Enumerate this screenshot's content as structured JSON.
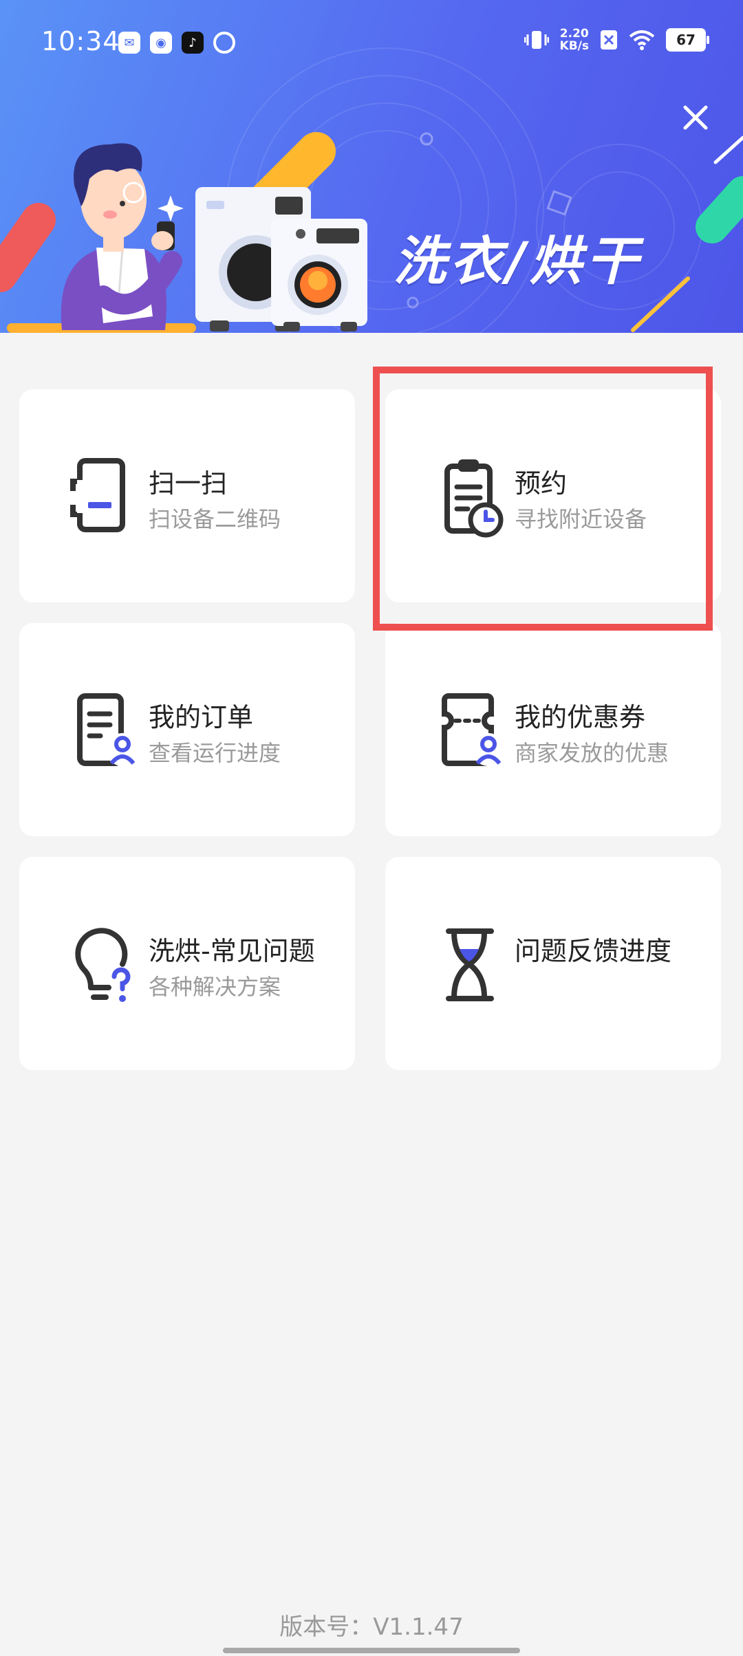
{
  "status_bar": {
    "time": "10:34",
    "net_speed_value": "2.20",
    "net_speed_unit": "KB/s",
    "battery": "67"
  },
  "banner": {
    "title": "洗衣/烘干"
  },
  "menu": [
    {
      "title": "扫一扫",
      "subtitle": "扫设备二维码",
      "icon": "scan-phone-icon"
    },
    {
      "title": "预约",
      "subtitle": "寻找附近设备",
      "icon": "clipboard-clock-icon"
    },
    {
      "title": "我的订单",
      "subtitle": "查看运行进度",
      "icon": "order-user-icon"
    },
    {
      "title": "我的优惠券",
      "subtitle": "商家发放的优惠",
      "icon": "coupon-user-icon"
    },
    {
      "title": "洗烘-常见问题",
      "subtitle": "各种解决方案",
      "icon": "lightbulb-question-icon"
    },
    {
      "title": "问题反馈进度",
      "subtitle": "",
      "icon": "hourglass-icon"
    }
  ],
  "footer": {
    "version": "版本号：V1.1.47"
  },
  "colors": {
    "accent": "#4b55e6",
    "highlight": "#ee5050",
    "banner_start": "#5a93f7",
    "banner_end": "#4d55e8"
  }
}
